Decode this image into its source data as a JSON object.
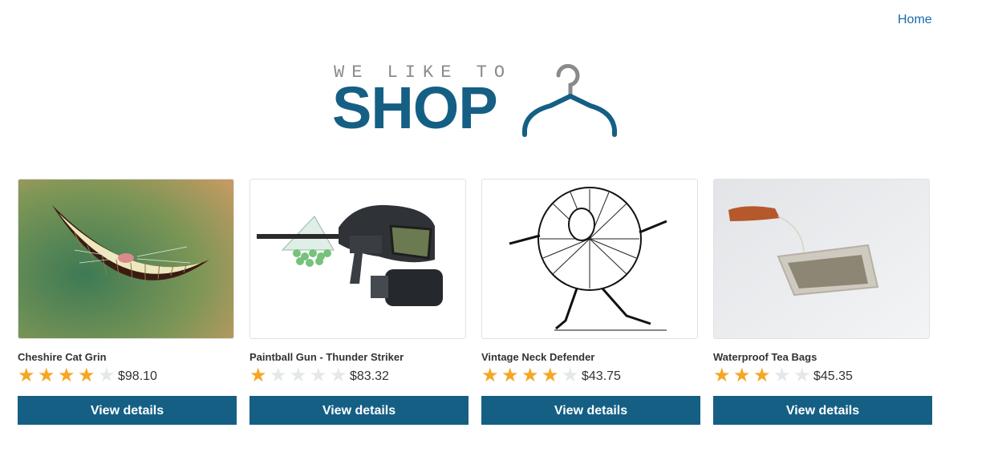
{
  "nav": {
    "home": "Home"
  },
  "logo": {
    "tagline": "WE LIKE TO",
    "word": "SHOP",
    "icon": "hanger-icon"
  },
  "colors": {
    "brand": "#155f85",
    "star": "#f5a623",
    "star_empty": "#e4e8ea"
  },
  "products": [
    {
      "name": "Cheshire Cat Grin",
      "rating": 4,
      "price": "$98.10",
      "button": "View details",
      "image": "cheshire-cat-grin-image"
    },
    {
      "name": "Paintball Gun - Thunder Striker",
      "rating": 1,
      "price": "$83.32",
      "button": "View details",
      "image": "paintball-gun-image"
    },
    {
      "name": "Vintage Neck Defender",
      "rating": 4,
      "price": "$43.75",
      "button": "View details",
      "image": "neck-defender-image"
    },
    {
      "name": "Waterproof Tea Bags",
      "rating": 3,
      "price": "$45.35",
      "button": "View details",
      "image": "tea-bag-image"
    }
  ]
}
